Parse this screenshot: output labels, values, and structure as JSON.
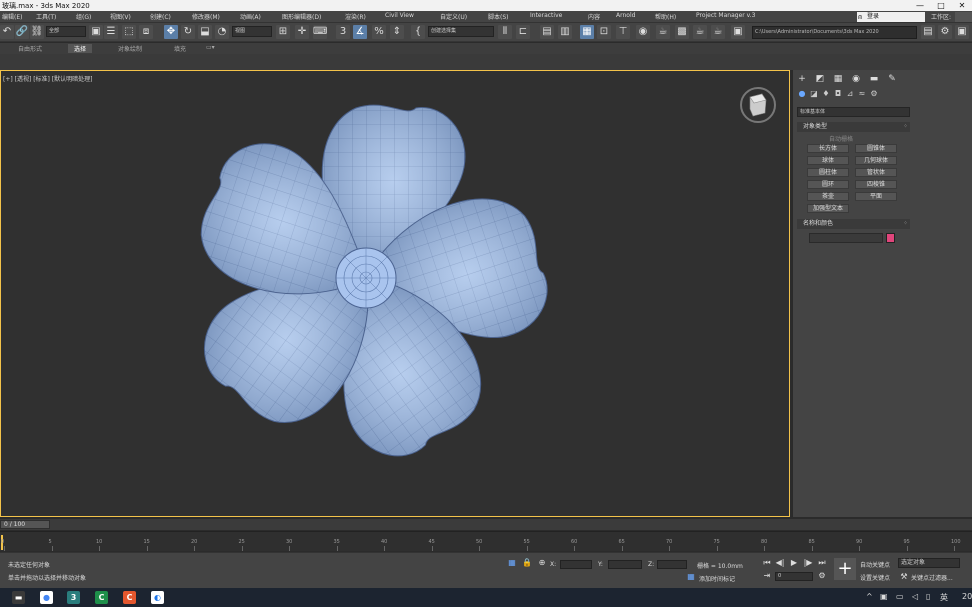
{
  "window": {
    "title": "玻璃.max - 3ds Max 2020",
    "minimize": "—",
    "maximize": "□",
    "close": "✕"
  },
  "menu": {
    "items": [
      "编辑(E)",
      "工具(T)",
      "组(G)",
      "视图(V)",
      "创建(C)",
      "修改器(M)",
      "动画(A)",
      "图形编辑器(D)",
      "渲染(R)",
      "Civil View",
      "自定义(U)",
      "脚本(S)",
      "Interactive",
      "内容",
      "Arnold",
      "帮助(H)",
      "Project Manager v.3"
    ],
    "search_placeholder": "登录",
    "workspace_label": "工作区:"
  },
  "toolbar": {
    "selection_filter": "全部",
    "view_dropdown": "视图",
    "named_selection": "创建选择集",
    "project_path": "C:\\Users\\Administrator\\Documents\\3ds Max 2020"
  },
  "ribbon": {
    "tabs": [
      "自由形式",
      "选择",
      "对象绘制",
      "填充"
    ],
    "active_index": 1
  },
  "viewport": {
    "label": "[+] [透视] [标准] [默认明暗处理]"
  },
  "command_panel": {
    "category_dropdown": "标准基本体",
    "object_type_title": "对象类型",
    "autogrid_label": "自动栅格",
    "object_buttons": [
      "长方体",
      "圆锥体",
      "球体",
      "几何球体",
      "圆柱体",
      "管状体",
      "圆环",
      "四棱锥",
      "茶壶",
      "平面",
      "加强型文本"
    ],
    "name_color_title": "名称和颜色",
    "object_color": "#e0457b"
  },
  "timeline": {
    "frame_display": "0 / 100",
    "ticks": [
      "0",
      "5",
      "10",
      "15",
      "20",
      "25",
      "30",
      "35",
      "40",
      "45",
      "50",
      "55",
      "60",
      "65",
      "70",
      "75",
      "80",
      "85",
      "90",
      "95",
      "100"
    ]
  },
  "status": {
    "selection_text": "未选定任何对象",
    "prompt_text": "单击并拖动以选择并移动对象",
    "grid_label": "栅格 = 10.0mm",
    "add_time_tag": "添加时间标记",
    "autokey_label": "自动关键点",
    "setkey_label": "设置关键点",
    "key_filter": "选定对象",
    "key_filters_btn": "关键点过滤器...",
    "frame_field": "0",
    "x_label": "X:",
    "y_label": "Y:",
    "z_label": "Z:"
  },
  "taskbar": {
    "time_partial": "20"
  }
}
